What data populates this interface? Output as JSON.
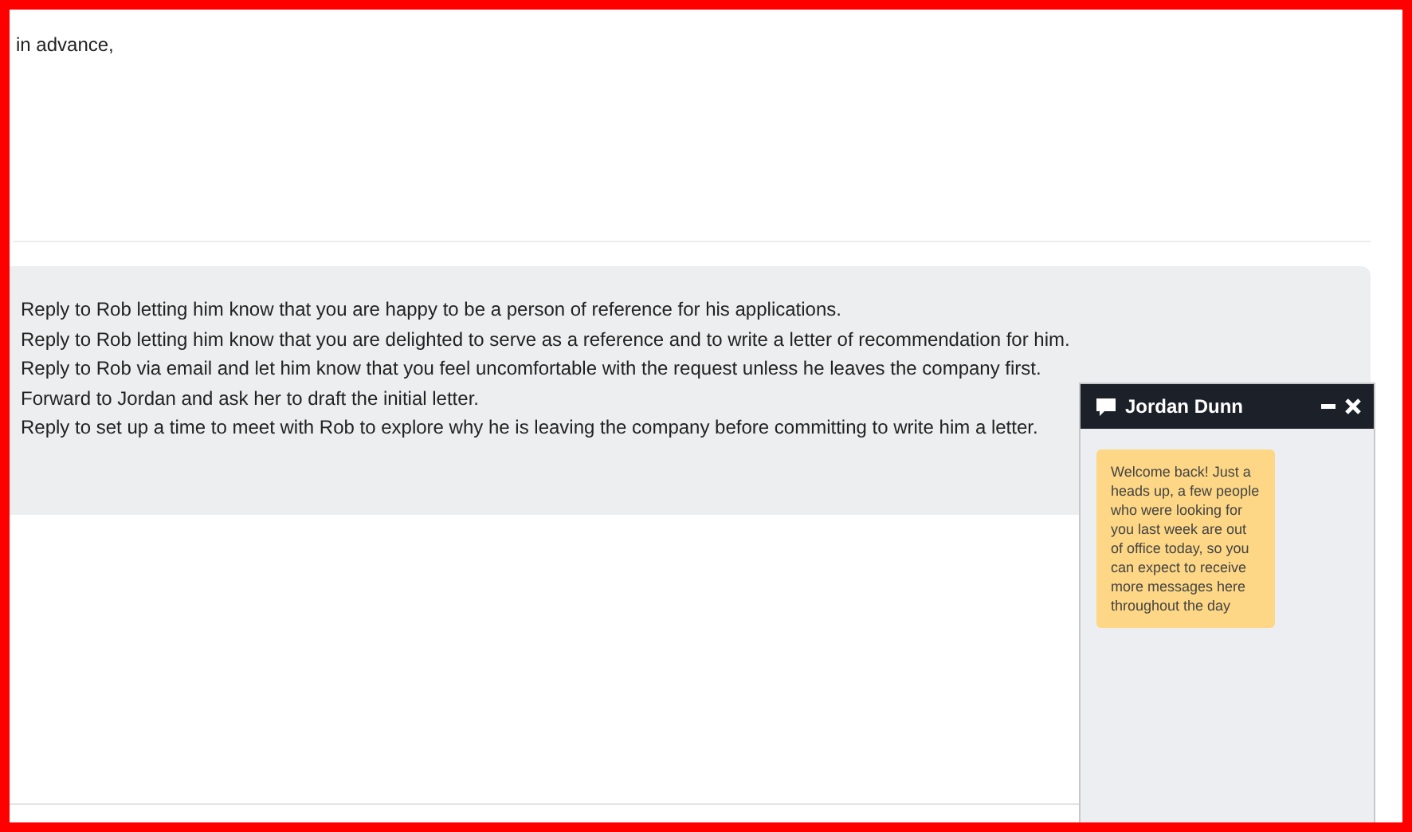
{
  "email": {
    "text": "in advance,"
  },
  "options": [
    {
      "label": "Reply to Rob letting him know that you are happy to be a person of reference for his applications."
    },
    {
      "label": "Reply to Rob letting him know that you are delighted to serve as a reference and to write a letter of recommendation for him."
    },
    {
      "label": "Reply to Rob via email and let him know that you feel uncomfortable with the request unless he leaves the company first."
    },
    {
      "label": "Forward to Jordan and ask her to draft the initial letter."
    },
    {
      "label": "Reply to set up a time to meet with Rob to explore why he is leaving the company before committing to write him a letter."
    }
  ],
  "chat": {
    "name": "Jordan Dunn",
    "messages": [
      {
        "text": "Welcome back! Just a heads up, a few people who were looking for you last week are out of office today, so you can expect to receive more messages here throughout the day"
      }
    ]
  }
}
